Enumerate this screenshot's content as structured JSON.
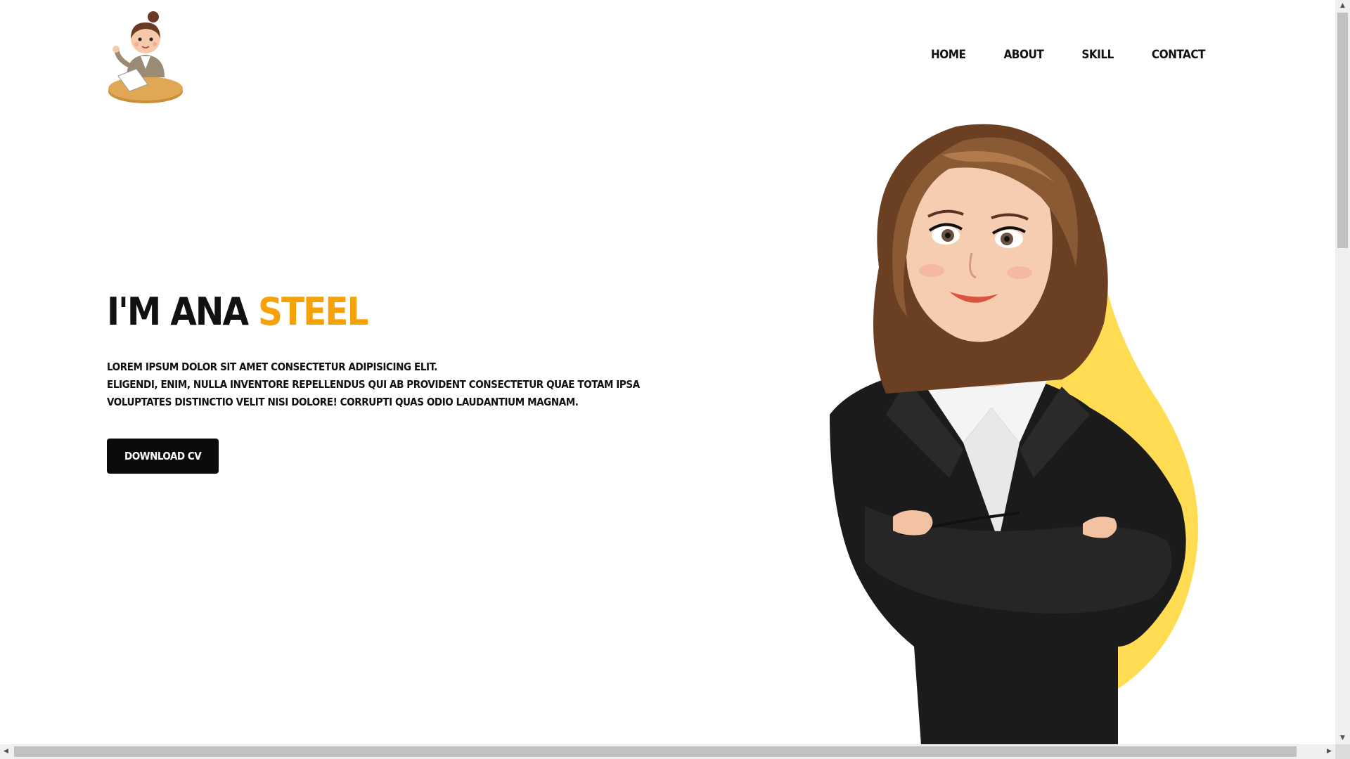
{
  "nav": {
    "items": [
      {
        "label": "HOME"
      },
      {
        "label": "ABOUT"
      },
      {
        "label": "SKILL"
      },
      {
        "label": "CONTACT"
      }
    ]
  },
  "hero": {
    "title_prefix": "I'M ANA ",
    "title_accent": "STEEL",
    "text_lines": [
      "LOREM IPSUM DOLOR SIT AMET CONSECTETUR ADIPISICING ELIT.",
      "ELIGENDI, ENIM, NULLA INVENTORE REPELLENDUS QUI AB PROVIDENT CONSECTETUR QUAE TOTAM IPSA",
      "VOLUPTATES DISTINCTIO VELIT NISI DOLORE! CORRUPTI QUAS ODIO LAUDANTIUM MAGNAM."
    ],
    "button_label": "DOWNLOAD CV"
  },
  "colors": {
    "accent": "#f5a20a",
    "blob": "#ffdc52",
    "text": "#111111",
    "button_bg": "#0b0b0b"
  },
  "icons": {
    "logo": "woman-at-desk-logo",
    "illustration": "businesswoman-illustration"
  }
}
